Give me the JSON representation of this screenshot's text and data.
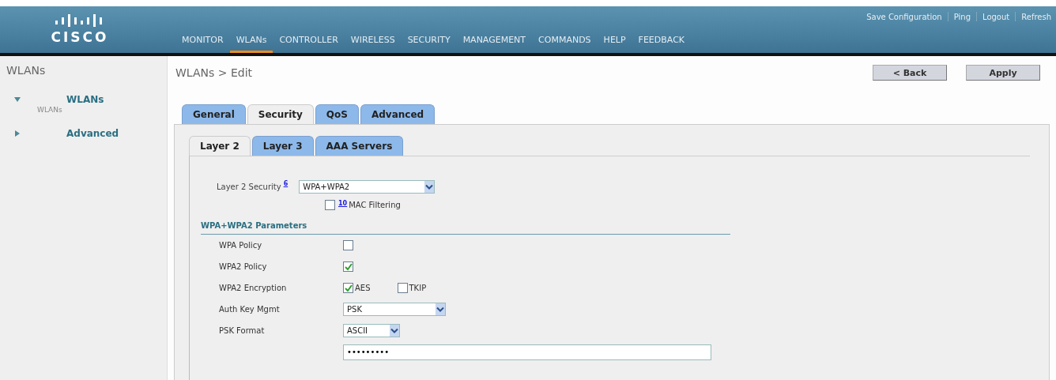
{
  "header": {
    "logo": "CISCO",
    "top_links": [
      "Save Configuration",
      "Ping",
      "Logout",
      "Refresh"
    ],
    "menu": [
      {
        "label": "MONITOR",
        "selected": false
      },
      {
        "label": "WLANs",
        "selected": true
      },
      {
        "label": "CONTROLLER",
        "selected": false
      },
      {
        "label": "WIRELESS",
        "selected": false
      },
      {
        "label": "SECURITY",
        "selected": false
      },
      {
        "label": "MANAGEMENT",
        "selected": false
      },
      {
        "label": "COMMANDS",
        "selected": false
      },
      {
        "label": "HELP",
        "selected": false
      },
      {
        "label": "FEEDBACK",
        "selected": false
      }
    ]
  },
  "sidebar": {
    "title": "WLANs",
    "items": [
      {
        "label": "WLANs",
        "expanded": true,
        "children": [
          {
            "label": "WLANs"
          }
        ]
      },
      {
        "label": "Advanced",
        "expanded": false
      }
    ]
  },
  "page_title": "WLANs > Edit",
  "buttons": [
    "< Back",
    "Apply"
  ],
  "tabs": [
    {
      "label": "General",
      "selected": false
    },
    {
      "label": "Security",
      "selected": true
    },
    {
      "label": "QoS",
      "selected": false
    },
    {
      "label": "Advanced",
      "selected": false
    }
  ],
  "subtabs": [
    {
      "label": "Layer 2",
      "selected": true
    },
    {
      "label": "Layer 3",
      "selected": false
    },
    {
      "label": "AAA Servers",
      "selected": false
    }
  ],
  "layer2_security": {
    "label": "Layer 2 Security",
    "footnote": "6",
    "value": "WPA+WPA2"
  },
  "mac_filtering": {
    "label": "MAC Filtering",
    "footnote": "10",
    "checked": false
  },
  "section_title": "WPA+WPA2 Parameters",
  "rows": [
    {
      "kind": "checkbox",
      "label": "WPA Policy",
      "checked": false
    },
    {
      "kind": "checkbox",
      "label": "WPA2 Policy",
      "checked": true
    },
    {
      "kind": "options",
      "label": "WPA2 Encryption",
      "options": [
        {
          "label": "AES",
          "checked": true
        },
        {
          "label": "TKIP",
          "checked": false
        }
      ]
    },
    {
      "kind": "select",
      "label": "Auth Key Mgmt",
      "value": "PSK"
    },
    {
      "kind": "short_select",
      "label": "PSK Format",
      "value": "ASCII"
    },
    {
      "kind": "password",
      "value": "•••••••••"
    }
  ]
}
